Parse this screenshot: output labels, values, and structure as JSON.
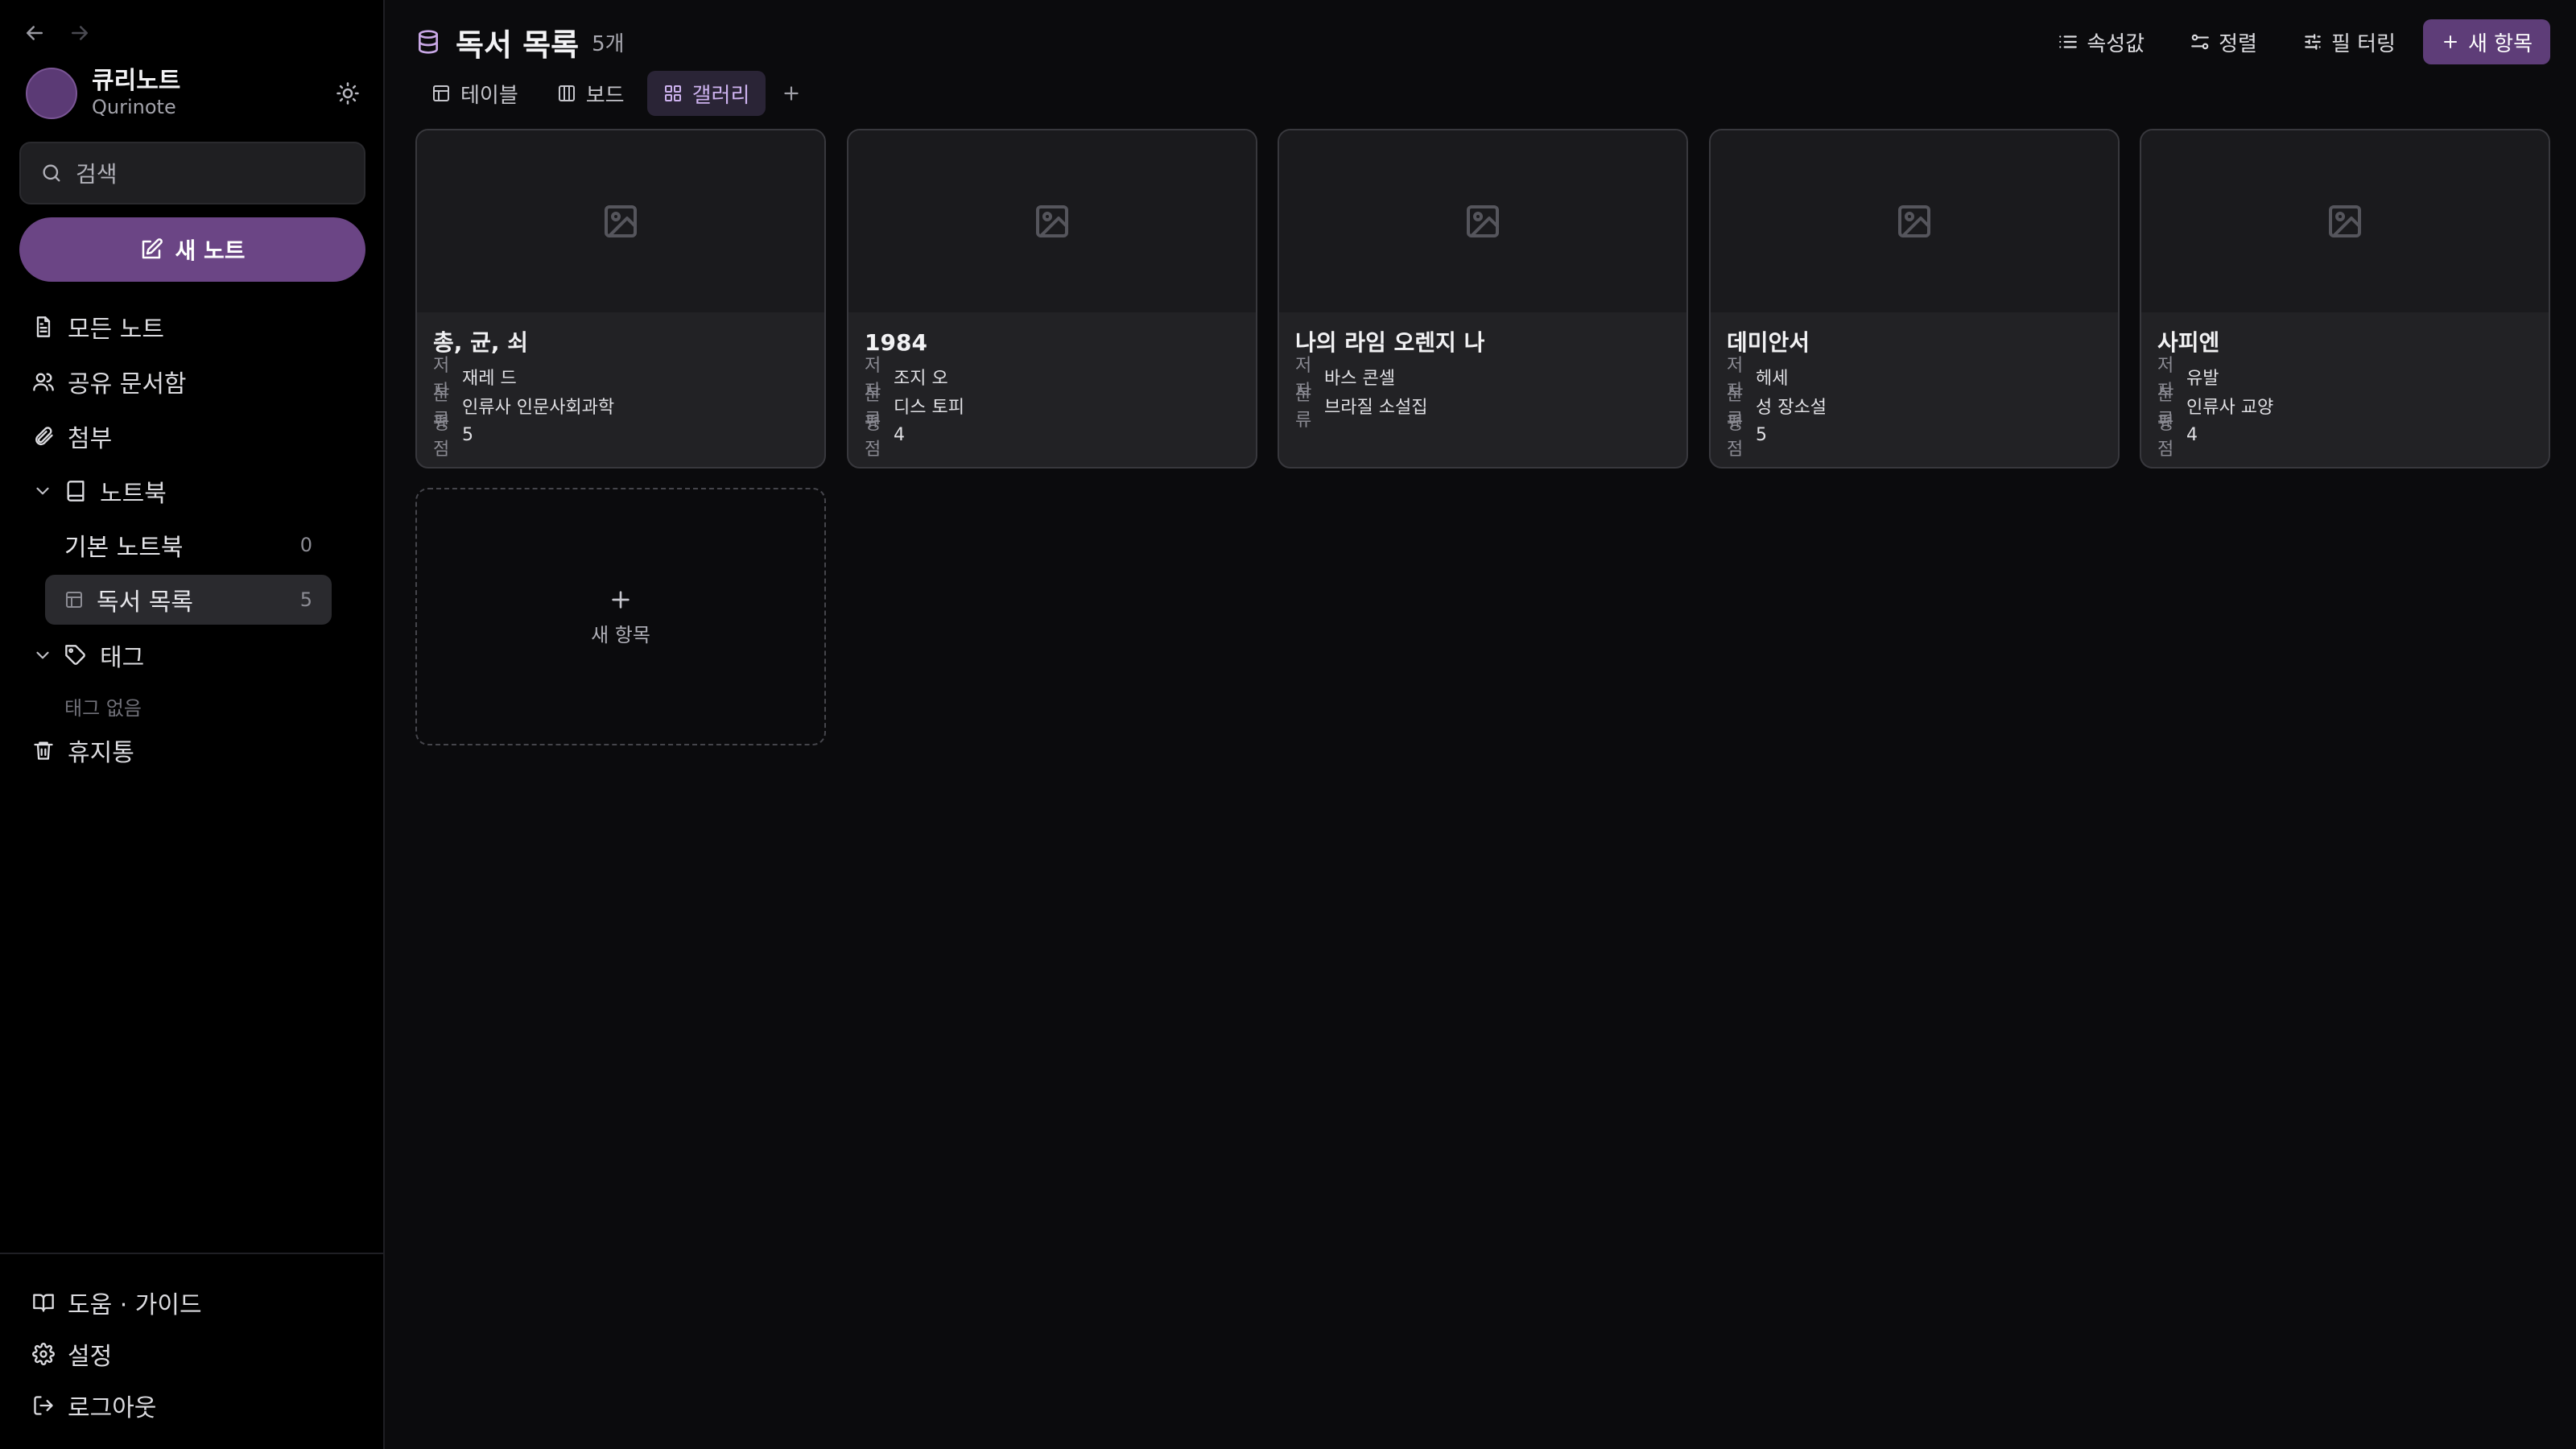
{
  "sidebar": {
    "brand": {
      "avatar": "",
      "name": "큐리노트",
      "subtitle": "Qurinote"
    },
    "search_placeholder": "검색",
    "new_button": "새 노트",
    "nav": [
      {
        "label": "모든 노트",
        "icon": "file-text-icon"
      },
      {
        "label": "공유 문서함",
        "icon": "users-icon"
      },
      {
        "label": "첨부",
        "icon": "paperclip-icon"
      }
    ],
    "notebooks": {
      "label": "노트북",
      "items": [
        {
          "label": "기본 노트북",
          "count": "0"
        },
        {
          "label": "독서 목록",
          "count": "5"
        }
      ]
    },
    "tags": {
      "label": "태그",
      "empty": "태그 없음"
    },
    "trash": "휴지통",
    "footer": [
      {
        "label": "도움 · 가이드",
        "icon": "book-open-icon"
      },
      {
        "label": "설정",
        "icon": "gear-icon"
      },
      {
        "label": "로그아웃",
        "icon": "logout-icon"
      }
    ]
  },
  "header": {
    "title": "독서 목록",
    "count": "5개"
  },
  "toolbar": {
    "properties": "속성값",
    "sort": "정렬",
    "filter": "필 터링",
    "new": "새 항목"
  },
  "tabs": [
    {
      "label": "테이블",
      "icon": "table-icon"
    },
    {
      "label": "보드",
      "icon": "columns-icon"
    },
    {
      "label": "갤러리",
      "icon": "grid-icon"
    }
  ],
  "cards": [
    {
      "title": "총, 균, 쇠",
      "props": [
        {
          "k": "저자",
          "v": "재레 드"
        },
        {
          "k": "분류",
          "v": "인류사 인문사회과학"
        },
        {
          "k": "평점",
          "v": "5"
        }
      ]
    },
    {
      "title": "1984",
      "props": [
        {
          "k": "저자",
          "v": "조지 오"
        },
        {
          "k": "분류",
          "v": "디스 토피"
        },
        {
          "k": "평점",
          "v": "4"
        }
      ]
    },
    {
      "title": "나의 라임 오렌지 나",
      "props": [
        {
          "k": "저자",
          "v": "바스 콘셀"
        },
        {
          "k": "분류",
          "v": "브라질 소설집"
        }
      ]
    },
    {
      "title": "데미안서",
      "props": [
        {
          "k": "저자",
          "v": "헤세"
        },
        {
          "k": "분류",
          "v": "성 장소설"
        },
        {
          "k": "평점",
          "v": "5"
        }
      ]
    },
    {
      "title": "사피엔",
      "props": [
        {
          "k": "저자",
          "v": "유발"
        },
        {
          "k": "분류",
          "v": "인류사 교양"
        },
        {
          "k": "평점",
          "v": "4"
        }
      ]
    }
  ],
  "add_card": "새 항목"
}
